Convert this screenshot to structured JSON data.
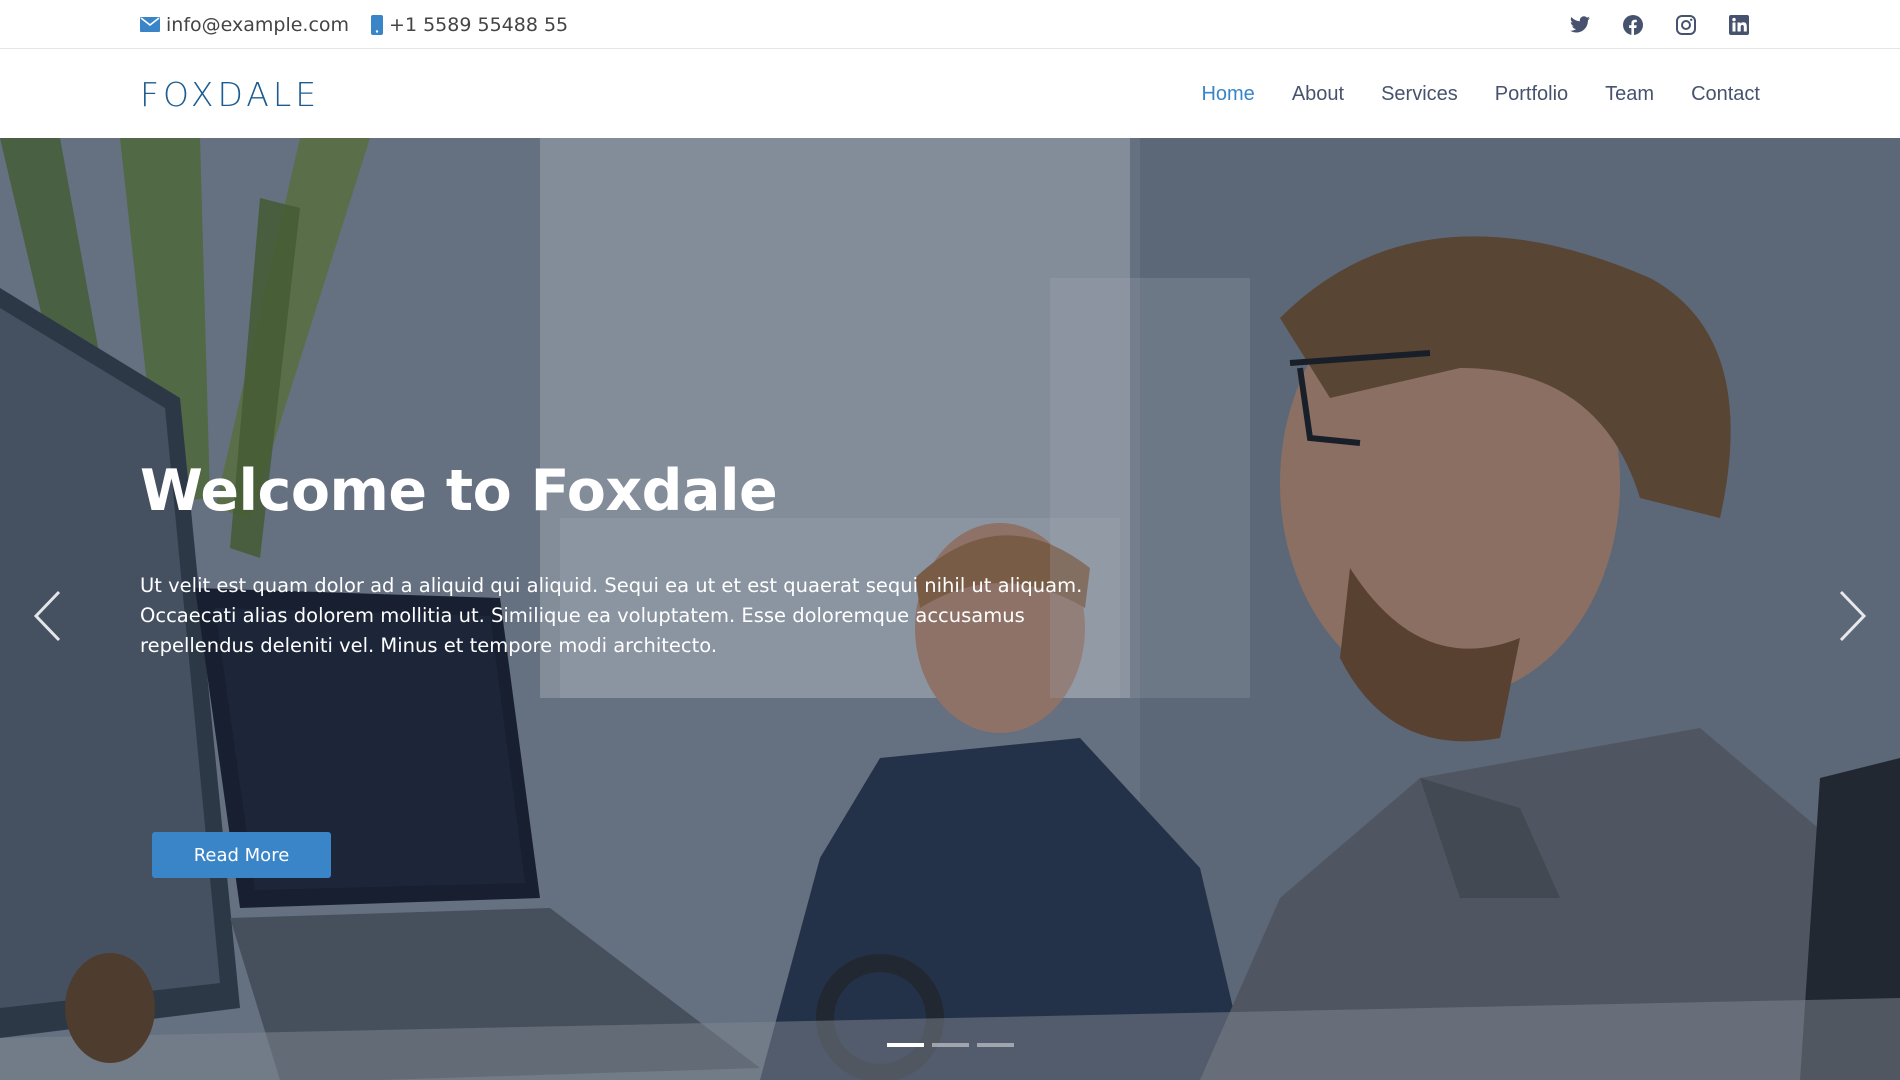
{
  "topbar": {
    "email": "info@example.com",
    "phone": "+1 5589 55488 55",
    "email_icon": "envelope-icon",
    "phone_icon": "mobile-phone-icon",
    "social": [
      "twitter-icon",
      "facebook-icon",
      "instagram-icon",
      "linkedin-icon"
    ]
  },
  "header": {
    "logo": "FOXDALE",
    "nav": [
      "Home",
      "About",
      "Services",
      "Portfolio",
      "Team",
      "Contact"
    ],
    "active_nav": "Home"
  },
  "hero": {
    "title": "Welcome to Foxdale",
    "text": "Ut velit est quam dolor ad a aliquid qui aliquid. Sequi ea ut et est quaerat sequi nihil ut aliquam. Occaecati alias dolorem mollitia ut. Similique ea voluptatem. Esse doloremque accusamus repellendus deleniti vel. Minus et tempore modi architecto.",
    "button": "Read More",
    "slide_count": 3,
    "active_slide": 1
  },
  "colors": {
    "accent": "#3a85c8",
    "logo": "#1c5c91",
    "nav_text": "#47536e"
  }
}
